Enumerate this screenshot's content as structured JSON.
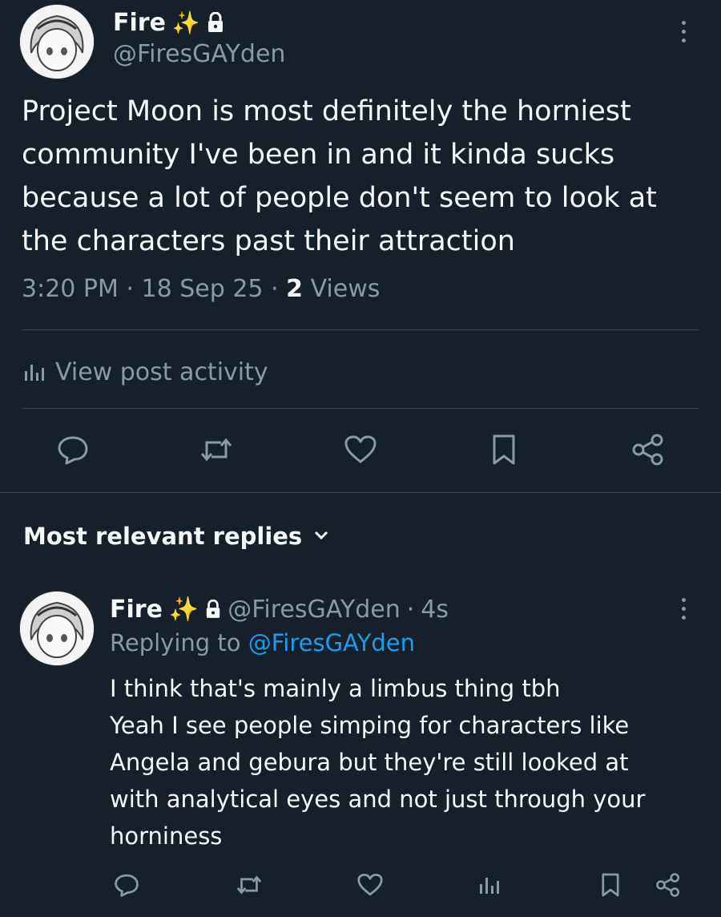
{
  "post": {
    "author_name": "Fire",
    "author_emoji": "✨",
    "author_handle": "@FiresGAYden",
    "text": "Project Moon is most definitely the horniest community I've been in and it kinda sucks because a lot of people don't seem to look at the characters past their attraction",
    "time": "3:20 PM",
    "date": "18 Sep 25",
    "views_count": "2",
    "views_label": "Views",
    "activity_label": "View post activity"
  },
  "replies_header": {
    "label": "Most relevant replies"
  },
  "reply": {
    "author_name": "Fire",
    "author_emoji": "✨",
    "author_handle": "@FiresGAYden",
    "age": "4s",
    "replying_prefix": "Replying to",
    "replying_handle": "@FiresGAYden",
    "lines": [
      "I think that's mainly a limbus thing tbh",
      "Yeah I see people simping for characters like",
      "Angela and gebura but they're still looked at",
      "with analytical eyes and not just through your",
      "horniness"
    ]
  },
  "separators": {
    "dot": "·"
  },
  "colors": {
    "background": "#15202b",
    "text": "#f7f9f9",
    "muted": "#8b98a5",
    "link": "#1d9bf0",
    "divider": "#38444d"
  }
}
